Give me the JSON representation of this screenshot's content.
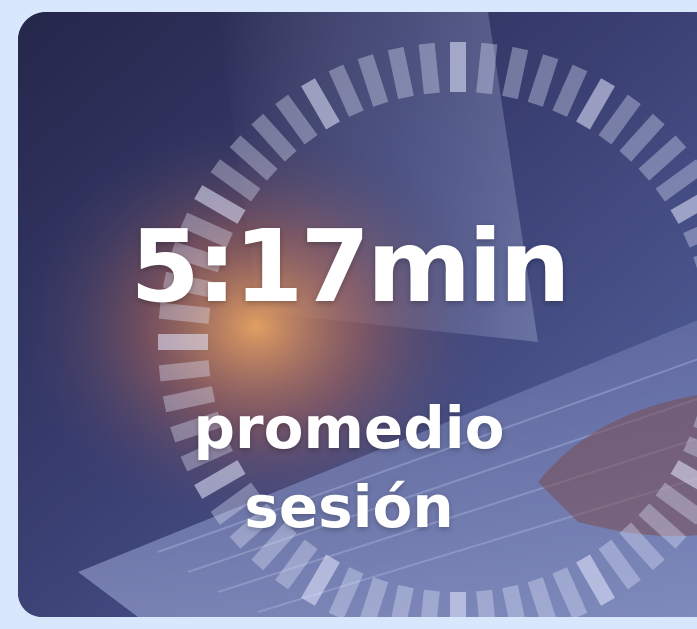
{
  "stat": {
    "value": "5:17min",
    "label_line1": "promedio",
    "label_line2": "sesión"
  },
  "theme": {
    "page_background": "#d8e7fb",
    "card_overlay": "#2d3260",
    "text_color": "#ffffff"
  },
  "icons": {
    "background": "laptop-typing-with-clock-dial-photo"
  }
}
